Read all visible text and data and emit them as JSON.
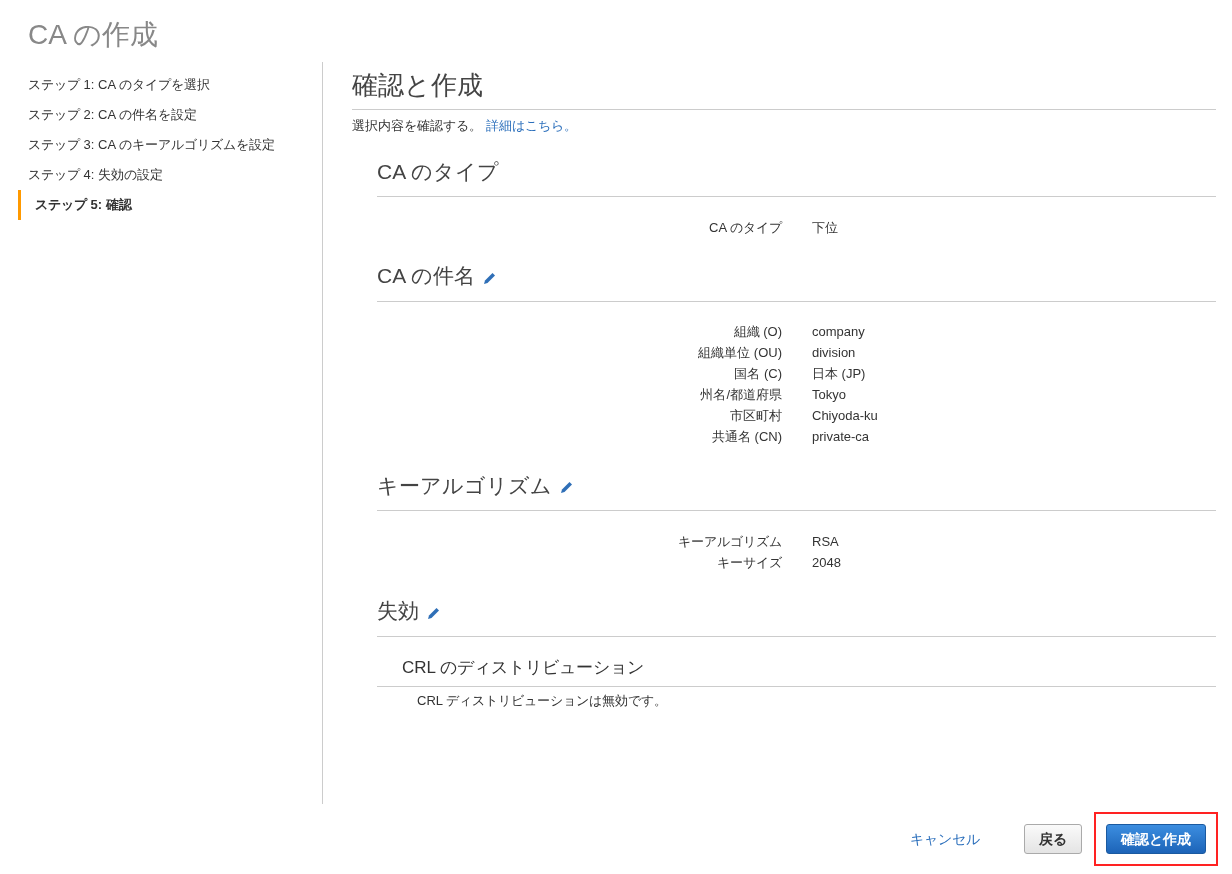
{
  "page_title": "CA の作成",
  "steps": [
    {
      "label": "ステップ 1: CA のタイプを選択",
      "selected": false
    },
    {
      "label": "ステップ 2: CA の件名を設定",
      "selected": false
    },
    {
      "label": "ステップ 3: CA のキーアルゴリズムを設定",
      "selected": false
    },
    {
      "label": "ステップ 4: 失効の設定",
      "selected": false
    },
    {
      "label": "ステップ 5: 確認",
      "selected": true
    }
  ],
  "heading": "確認と作成",
  "description": {
    "text": "選択内容を確認する。",
    "link": "詳細はこちら。"
  },
  "sections": [
    {
      "title": "CA のタイプ",
      "editable": false,
      "kind": "fields",
      "rows": [
        {
          "label": "CA のタイプ",
          "value": "下位"
        }
      ]
    },
    {
      "title": "CA の件名",
      "editable": true,
      "kind": "fields",
      "rows": [
        {
          "label": "組織 (O)",
          "value": "company"
        },
        {
          "label": "組織単位 (OU)",
          "value": "division"
        },
        {
          "label": "国名 (C)",
          "value": "日本 (JP)"
        },
        {
          "label": "州名/都道府県",
          "value": "Tokyo"
        },
        {
          "label": "市区町村",
          "value": "Chiyoda-ku"
        },
        {
          "label": "共通名 (CN)",
          "value": "private-ca"
        }
      ]
    },
    {
      "title": "キーアルゴリズム",
      "editable": true,
      "kind": "fields",
      "rows": [
        {
          "label": "キーアルゴリズム",
          "value": "RSA"
        },
        {
          "label": "キーサイズ",
          "value": "2048"
        }
      ]
    },
    {
      "title": "失効",
      "editable": true,
      "kind": "subsection",
      "subtitle": "CRL のディストリビューション",
      "note": "CRL ディストリビューションは無効です。"
    }
  ],
  "footer": {
    "cancel": "キャンセル",
    "back": "戻る",
    "create": {
      "label": "確認と作成",
      "highlighted": true
    }
  }
}
